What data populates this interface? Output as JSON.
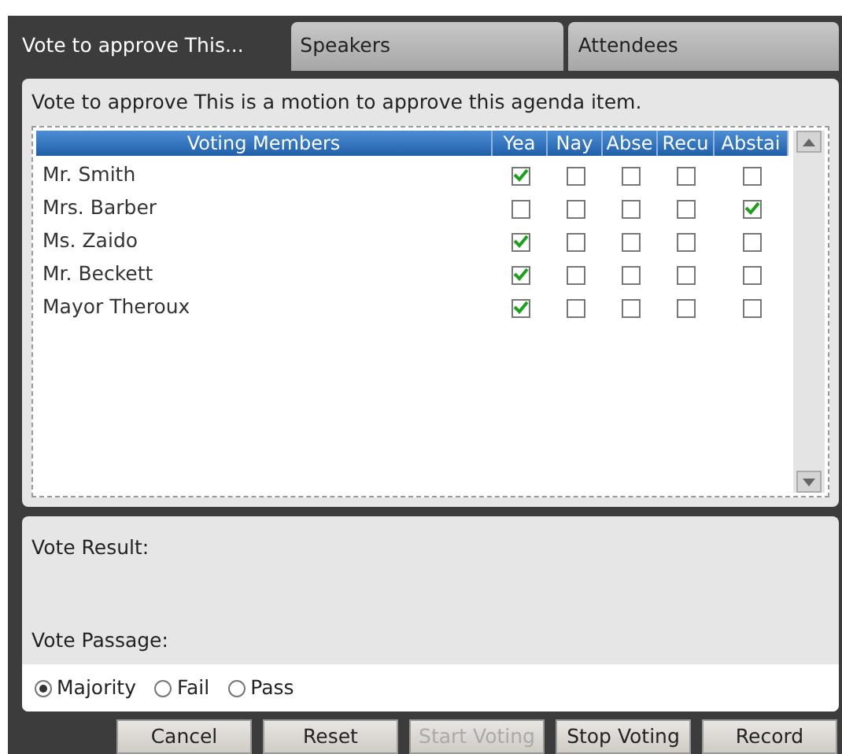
{
  "tabs": [
    {
      "label": "Vote to approve This...",
      "selected": true
    },
    {
      "label": "Speakers",
      "selected": false
    },
    {
      "label": "Attendees",
      "selected": false
    }
  ],
  "description": "Vote to approve This is a motion to approve this agenda item.",
  "table": {
    "columns": [
      "Voting Members",
      "Yea",
      "Nay",
      "Abse",
      "Recu",
      "Abstai"
    ],
    "rows": [
      {
        "name": "Mr. Smith",
        "votes": [
          true,
          false,
          false,
          false,
          false
        ]
      },
      {
        "name": "Mrs. Barber",
        "votes": [
          false,
          false,
          false,
          false,
          true
        ]
      },
      {
        "name": "Ms. Zaido",
        "votes": [
          true,
          false,
          false,
          false,
          false
        ]
      },
      {
        "name": "Mr. Beckett",
        "votes": [
          true,
          false,
          false,
          false,
          false
        ]
      },
      {
        "name": "Mayor Theroux",
        "votes": [
          true,
          false,
          false,
          false,
          false
        ]
      }
    ]
  },
  "vote_result": {
    "label": "Vote Result:"
  },
  "vote_passage": {
    "label": "Vote Passage:",
    "options": [
      {
        "label": "Majority",
        "selected": true
      },
      {
        "label": "Fail",
        "selected": false
      },
      {
        "label": "Pass",
        "selected": false
      }
    ]
  },
  "buttons": [
    {
      "label": "Cancel",
      "disabled": false
    },
    {
      "label": "Reset",
      "disabled": false
    },
    {
      "label": "Start Voting",
      "disabled": true
    },
    {
      "label": "Stop Voting",
      "disabled": false
    },
    {
      "label": "Record",
      "disabled": false
    }
  ]
}
